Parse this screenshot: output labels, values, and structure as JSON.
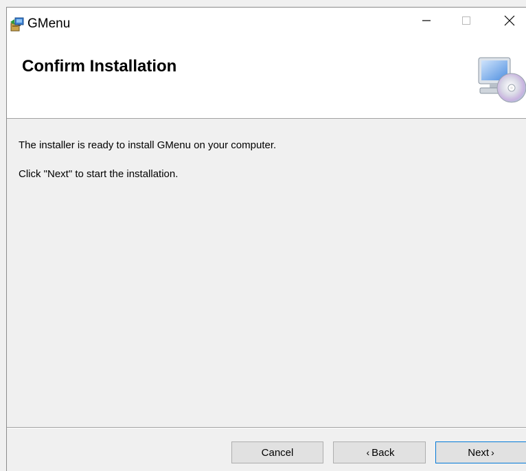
{
  "window": {
    "title": "GMenu",
    "app_icon": "installer-package-icon",
    "controls": {
      "minimize_icon": "minimize-icon",
      "maximize_icon": "maximize-icon",
      "close_icon": "close-icon"
    }
  },
  "header": {
    "title": "Confirm Installation",
    "graphic_icon": "computer-with-cd-icon"
  },
  "body": {
    "line1": "The installer is ready to install GMenu on your computer.",
    "line2": "Click \"Next\" to start the installation."
  },
  "buttons": {
    "cancel_label": "Cancel",
    "back_label": "Back",
    "back_chevron": "‹",
    "next_label": "Next",
    "next_chevron": "›"
  },
  "colors": {
    "window_bg": "#f0f0f0",
    "header_bg": "#ffffff",
    "button_bg": "#e1e1e1",
    "default_button_border": "#0078d7"
  }
}
